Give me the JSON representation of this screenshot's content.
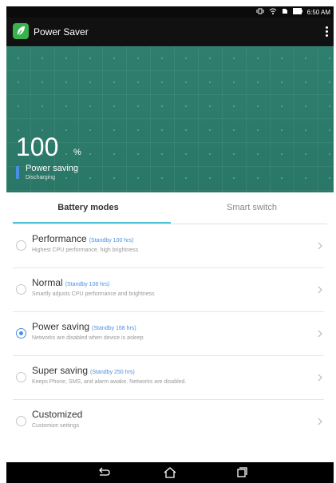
{
  "status_bar": {
    "time": "6:50 AM",
    "icons": [
      "vibrate-icon",
      "wifi-icon",
      "sim-icon",
      "battery-icon"
    ]
  },
  "app_bar": {
    "title": "Power Saver"
  },
  "hero": {
    "battery_percent": "100",
    "battery_unit": "%",
    "mode": "Power saving",
    "state": "Discharging"
  },
  "tabs": [
    {
      "label": "Battery modes",
      "active": true
    },
    {
      "label": "Smart switch",
      "active": false
    }
  ],
  "modes": [
    {
      "title": "Performance",
      "standby": "(Standby 100 hrs)",
      "desc": "Highest CPU performance, high brightness",
      "checked": false
    },
    {
      "title": "Normal",
      "standby": "(Standby 108 hrs)",
      "desc": "Smartly adjusts CPU performance and brightness",
      "checked": false
    },
    {
      "title": "Power saving",
      "standby": "(Standby 168 hrs)",
      "desc": "Networks are disabled when device is asleep",
      "checked": true
    },
    {
      "title": "Super saving",
      "standby": "(Standby 250 hrs)",
      "desc": "Keeps Phone, SMS, and alarm awake. Networks are disabled.",
      "checked": false
    },
    {
      "title": "Customized",
      "standby": "",
      "desc": "Customize settings",
      "checked": false
    }
  ],
  "colors": {
    "hero": "#2f7f6f",
    "accent": "#4a90e2",
    "tab_underline": "#4ec2d8",
    "app_icon": "#37b24d"
  }
}
